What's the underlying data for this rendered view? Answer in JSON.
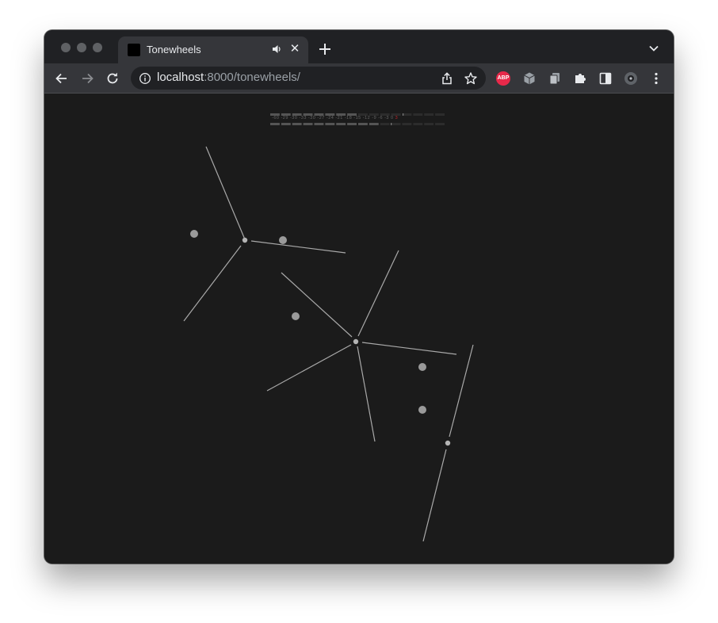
{
  "browser": {
    "tab": {
      "title": "Tonewheels"
    },
    "address_bar": {
      "host": "localhost",
      "rest": ":8000/tonewheels/"
    },
    "extensions": {
      "abp_label": "ABP"
    }
  },
  "meter": {
    "scale_labels": [
      "-60",
      "-29",
      "-30",
      "-33",
      "-30",
      "-27",
      "-24",
      "-21",
      "-18",
      "-15",
      "-12",
      "-9",
      "-6",
      "-3",
      "0"
    ],
    "peak_label": "3",
    "colors": {
      "active": "#555555",
      "inactive": "#2c2c2c",
      "peak": "#c1232b"
    }
  },
  "visualization": {
    "colors": {
      "line": "#a9a9a9",
      "hub": "#b5b5b5",
      "dot": "#9a9a9a"
    }
  },
  "icons": [
    "back-arrow-icon",
    "forward-arrow-icon",
    "reload-icon",
    "info-icon",
    "share-icon",
    "star-icon",
    "speaker-icon",
    "close-icon",
    "plus-icon",
    "chevron-down-icon",
    "puzzle-icon",
    "sidepanel-icon",
    "kebab-menu-icon"
  ]
}
